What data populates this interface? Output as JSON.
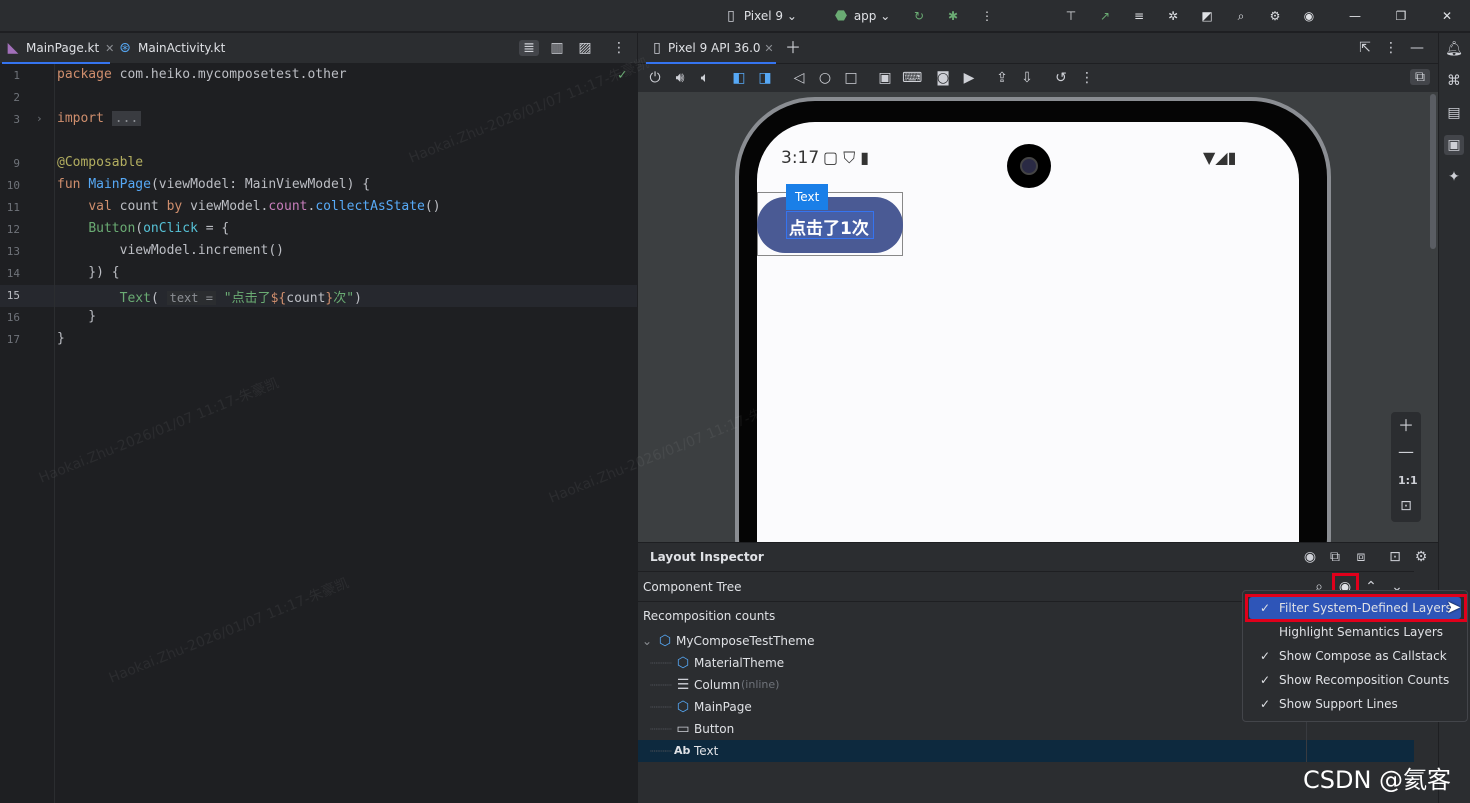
{
  "topbar": {
    "device": "Pixel 9",
    "module": "app"
  },
  "editor": {
    "tabs": [
      {
        "label": "MainPage.kt",
        "active": true
      },
      {
        "label": "MainActivity.kt",
        "active": false
      }
    ],
    "lines": [
      {
        "n": "1"
      },
      {
        "n": "2"
      },
      {
        "n": "3"
      },
      {
        "n": "9"
      },
      {
        "n": "10"
      },
      {
        "n": "11"
      },
      {
        "n": "12"
      },
      {
        "n": "13"
      },
      {
        "n": "14"
      },
      {
        "n": "15"
      },
      {
        "n": "16"
      },
      {
        "n": "17"
      }
    ]
  },
  "run": {
    "tab": "Pixel 9 API 36.0"
  },
  "phone": {
    "time": "3:17",
    "button_label": "点击了1次",
    "overlay_tag": "Text"
  },
  "zoom": {
    "ratio": "1:1"
  },
  "inspector": {
    "title": "Layout Inspector",
    "component_tree": "Component Tree",
    "recomposition": "Recomposition counts",
    "tree": [
      {
        "label": "MyComposeTestTheme",
        "extra": ""
      },
      {
        "label": "MaterialTheme",
        "extra": ""
      },
      {
        "label": "Column",
        "extra": "(inline)"
      },
      {
        "label": "MainPage",
        "extra": ""
      },
      {
        "label": "Button",
        "extra": ""
      },
      {
        "label": "Text",
        "extra": ""
      }
    ]
  },
  "popup": {
    "items": [
      {
        "label": "Filter System-Defined Layers",
        "checked": true
      },
      {
        "label": "Highlight Semantics Layers",
        "checked": false
      },
      {
        "label": "Show Compose as Callstack",
        "checked": true
      },
      {
        "label": "Show Recomposition Counts",
        "checked": true
      },
      {
        "label": "Show Support Lines",
        "checked": true
      }
    ]
  },
  "watermark": "CSDN @氦客",
  "wm_text": "Haokai.Zhu-2026/01/07 11:17-朱豪凯",
  "colors": {
    "accent": "#3574f0",
    "highlight": "#e0001b",
    "selected_row": "#0d293e"
  }
}
